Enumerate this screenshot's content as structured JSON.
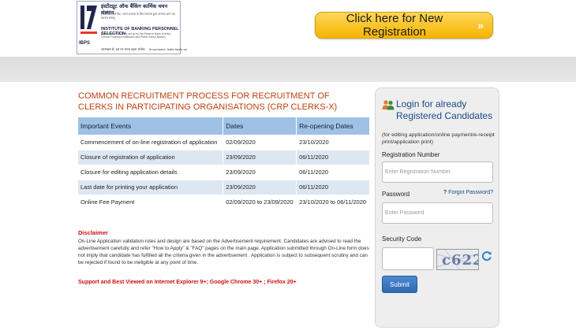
{
  "header": {
    "logo": {
      "hindi_title": "इंस्टीट्यूट ऑफ बैंकिंग कार्मिक चयन संस्थान",
      "hindi_sub": "(भारतीय रिज़र्व बैंक, भारत सरकार के वित्त मंत्रालय द्वारा मान्यता प्राप्त एक स्वायत्त संस्था)",
      "english_title": "INSTITUTE OF BANKING PERSONNEL SELECTION",
      "english_sub": "(An autonomous body set up by the Reserve Bank of India, Central Financial Institutions and Public Sector Banks)",
      "tagline_hindi": "आत्मबल से, हम पर भारत रहता भरोसा",
      "tagline_en": "In comment, India trusts us",
      "abbr": "IBPS"
    },
    "registration_button": "Click here for New Registration",
    "registration_arrow": "»"
  },
  "main": {
    "title": "COMMON RECRUITMENT PROCESS FOR RECRUITMENT OF CLERKS IN PARTICIPATING ORGANISATIONS (CRP CLERKS-X)",
    "table": {
      "headers": [
        "Important Events",
        "Dates",
        "Re-opening Dates"
      ],
      "rows": [
        [
          "Commencement of on-line registration of application",
          "02/09/2020",
          "23/10/2020"
        ],
        [
          "Closure of registration of application",
          "23/09/2020",
          "06/11/2020"
        ],
        [
          "Closure for editing application details",
          "23/09/2020",
          "06/11/2020"
        ],
        [
          "Last date for printing your application",
          "23/09/2020",
          "06/11/2020"
        ],
        [
          "Online Fee Payment",
          "02/09/2020 to 23/09/2020",
          "23/10/2020 to 06/11/2020"
        ]
      ]
    },
    "disclaimer_title": "Disclaimer",
    "disclaimer_text": "On-Line Application validation rules and design are based on the Advertisement requirement. Candidates are advised to read the advertisement carefully and refer \"How to Apply\" & \"FAQ\" pages on the main page. Application submitted through On-Line form does not imply that candidate has fulfilled all the criteria given in the advertisement . Application is subject to subsequent scrutiny and can be rejected if found to be ineligible at any point of time.",
    "support_text": "Support and Best Viewed on Internet Explorer 9+; Google Chrome 30+ ; Firefox 20+"
  },
  "login": {
    "title": "Login for already Registered Candidates",
    "note": "(for editing application/online payment/e-receipt print/application print)",
    "registration_label": "Registration Number",
    "registration_placeholder": "Enter Registration Number",
    "password_label": "Password",
    "password_placeholder": "Enter Password",
    "forgot_link": "Forgot Password?",
    "forgot_prefix": "?",
    "security_label": "Security Code",
    "captcha_text": "c622z",
    "submit_label": "Submit"
  },
  "colors": {
    "accent_orange": "#c0400b",
    "table_header": "#9fc1e5",
    "button_yellow": "#f6b400",
    "submit_blue": "#2f69b1",
    "disclaimer_red": "#cc1111"
  },
  "icons": {
    "logo": "ibps-logo-icon",
    "login": "users-icon",
    "refresh": "refresh-icon",
    "arrow": "double-chevron-right-icon"
  }
}
